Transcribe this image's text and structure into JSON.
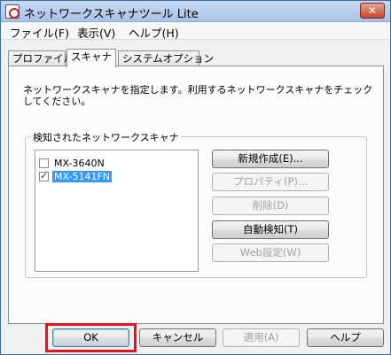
{
  "window": {
    "title": "ネットワークスキャナツール Lite",
    "close_label": "✕"
  },
  "menu": [
    {
      "label": "ファイル(F)"
    },
    {
      "label": "表示(V)"
    },
    {
      "label": "ヘルプ(H)"
    }
  ],
  "tabs": [
    {
      "label": "プロファイル",
      "active": false
    },
    {
      "label": "スキャナ",
      "active": true
    },
    {
      "label": "システムオプション",
      "active": false
    }
  ],
  "panel": {
    "description": "ネットワークスキャナを指定します。利用するネットワークスキャナをチェックしてください。",
    "group_label": "検知されたネットワークスキャナ",
    "scanners": [
      {
        "name": "MX-3640N",
        "checked": false,
        "selected": false
      },
      {
        "name": "MX-5141FN",
        "checked": true,
        "selected": true
      }
    ],
    "buttons": {
      "new": "新規作成(E)...",
      "properties": "プロパティ(P)...",
      "delete": "削除(D)",
      "autodetect": "自動検知(T)",
      "web": "Web設定(W)"
    }
  },
  "footer": {
    "ok": "OK",
    "cancel": "キャンセル",
    "apply": "適用(A)",
    "help": "ヘルプ"
  },
  "colors": {
    "highlight": "#e8121a",
    "selection": "#3399ff"
  }
}
